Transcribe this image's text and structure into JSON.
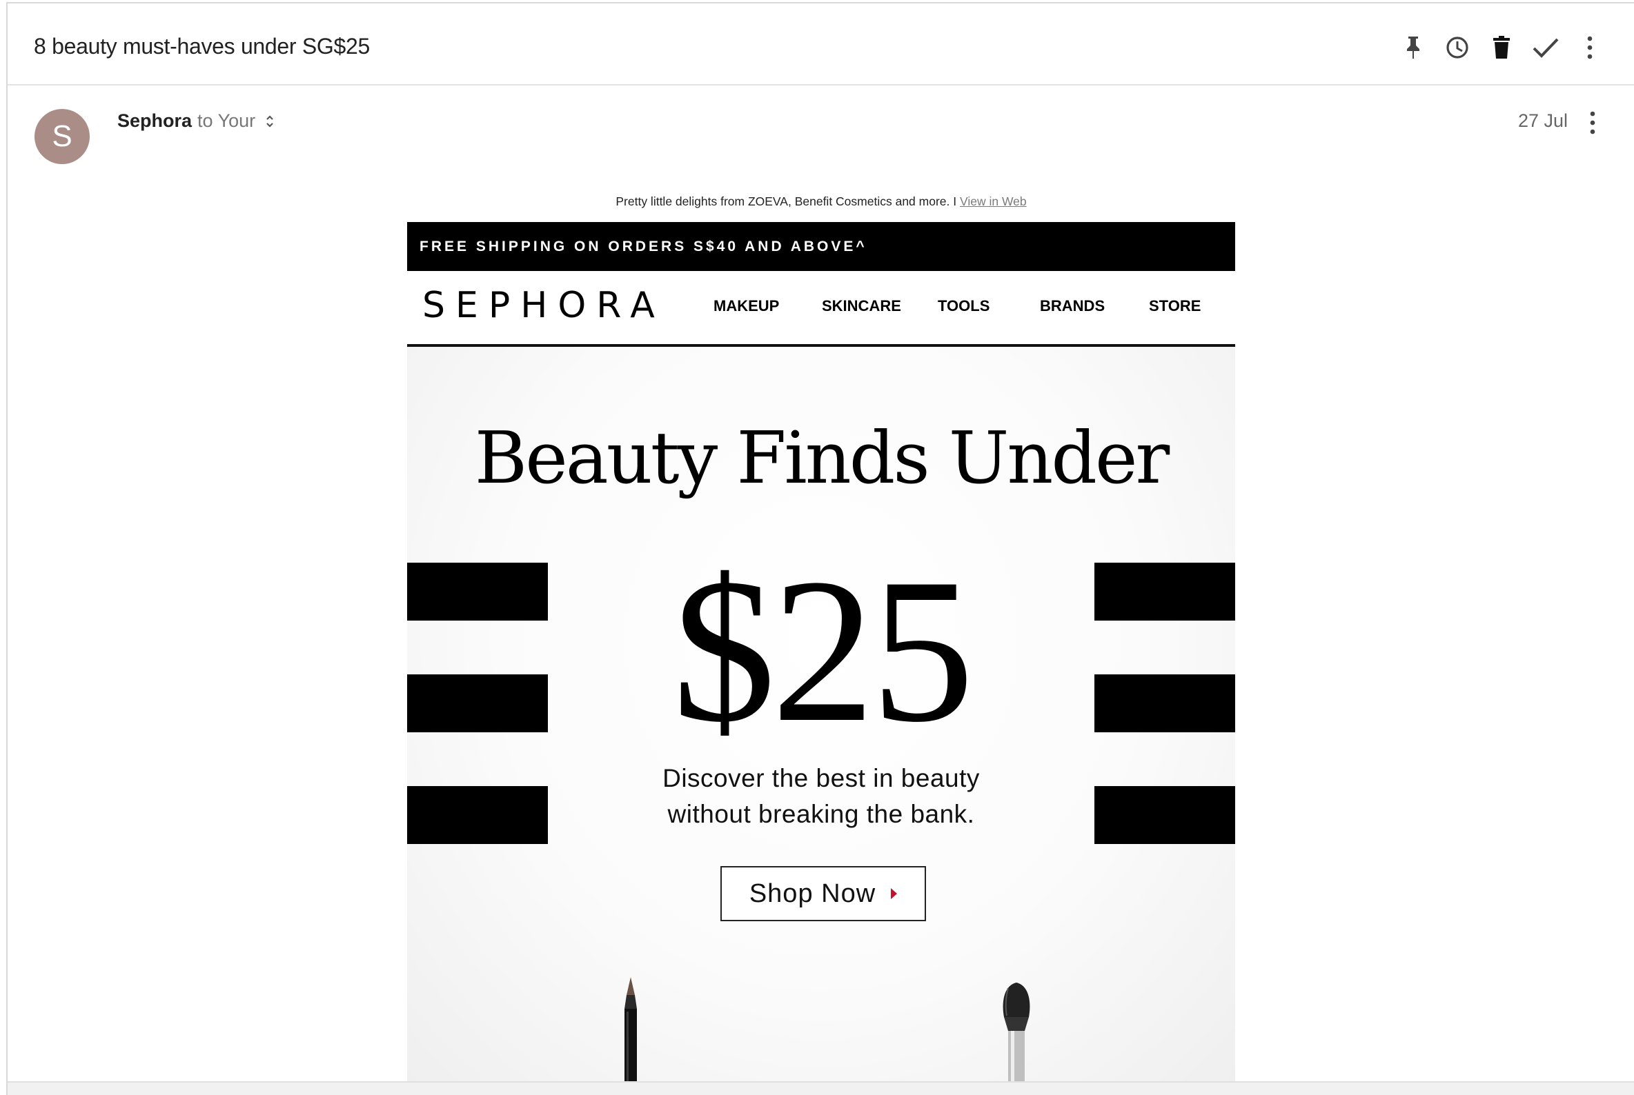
{
  "email": {
    "subject": "8 beauty must-haves under SG$25",
    "toolbar": {
      "icons": [
        "pin-icon",
        "snooze-clock-icon",
        "trash-icon",
        "done-check-icon",
        "more-vert-icon"
      ]
    },
    "sender": {
      "avatar_letter": "S",
      "avatar_color": "#a98d86",
      "name": "Sephora",
      "to_text": "to Your",
      "date": "27 Jul"
    }
  },
  "newsletter": {
    "preheader_text": "Pretty little delights from ZOEVA, Benefit Cosmetics and more. I",
    "view_in_web": "View in Web",
    "shipping_banner": "FREE SHIPPING ON ORDERS S$40 AND ABOVE^",
    "logo": "SEPHORA",
    "nav": [
      "MAKEUP",
      "SKINCARE",
      "TOOLS",
      "BRANDS",
      "STORE"
    ],
    "hero": {
      "title": "Beauty Finds Under",
      "price": "$25",
      "desc_line1": "Discover the best in beauty",
      "desc_line2": "without breaking the bank.",
      "cta": "Shop Now",
      "cta_arrow_color": "#c8102e"
    }
  }
}
